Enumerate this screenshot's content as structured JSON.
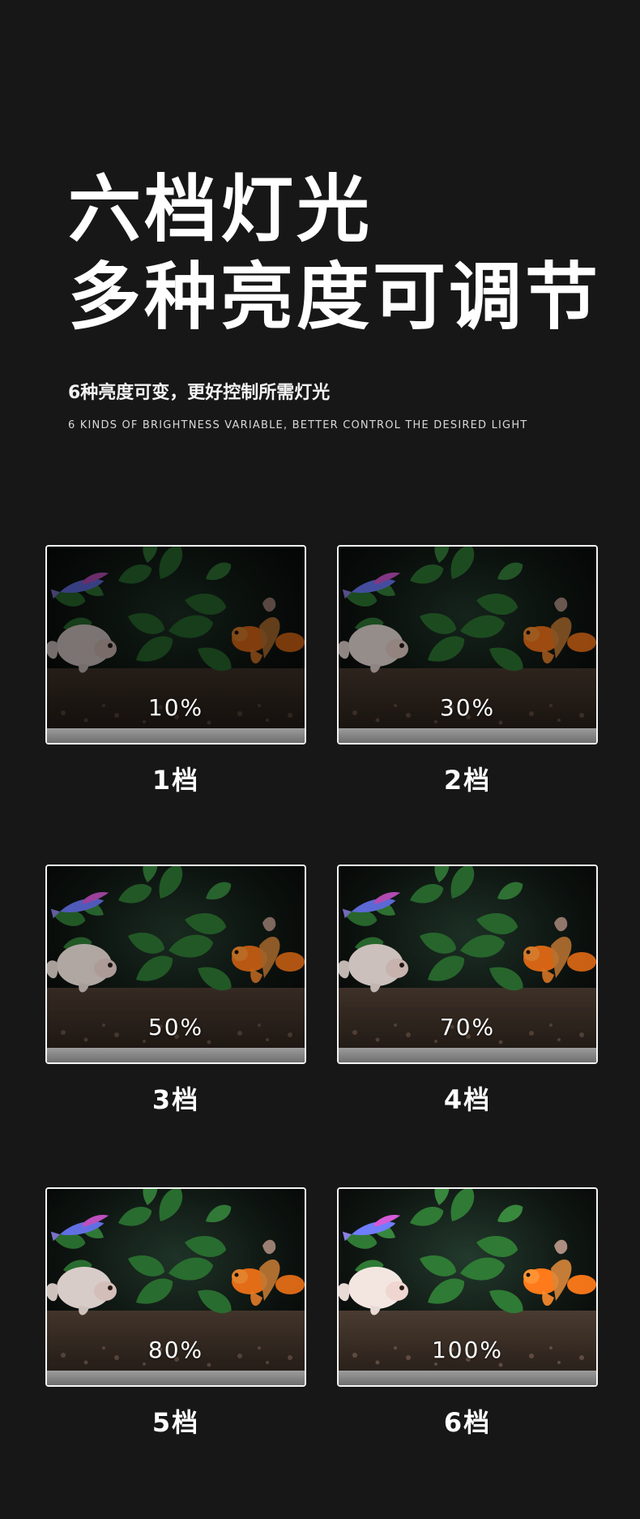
{
  "hero": {
    "title_line1": "六档灯光",
    "title_line2": "多种亮度可调节",
    "subtitle_cn": "6种亮度可变，更好控制所需灯光",
    "subtitle_en": "6 KINDS OF BRIGHTNESS VARIABLE, BETTER CONTROL THE DESIRED LIGHT"
  },
  "levels": [
    {
      "percent": "10%",
      "label": "1档",
      "brightness": 0.1
    },
    {
      "percent": "30%",
      "label": "2档",
      "brightness": 0.3
    },
    {
      "percent": "50%",
      "label": "3档",
      "brightness": 0.5
    },
    {
      "percent": "70%",
      "label": "4档",
      "brightness": 0.7
    },
    {
      "percent": "80%",
      "label": "5档",
      "brightness": 0.8
    },
    {
      "percent": "100%",
      "label": "6档",
      "brightness": 1.0
    }
  ],
  "colors": {
    "background": "#171717",
    "text": "#ffffff",
    "frame": "#f4f4f4",
    "plant": "#2e7d32",
    "goldfish": "#ff7a1a",
    "white_fish": "#f3e6e1",
    "tetra": "#b06cff"
  }
}
